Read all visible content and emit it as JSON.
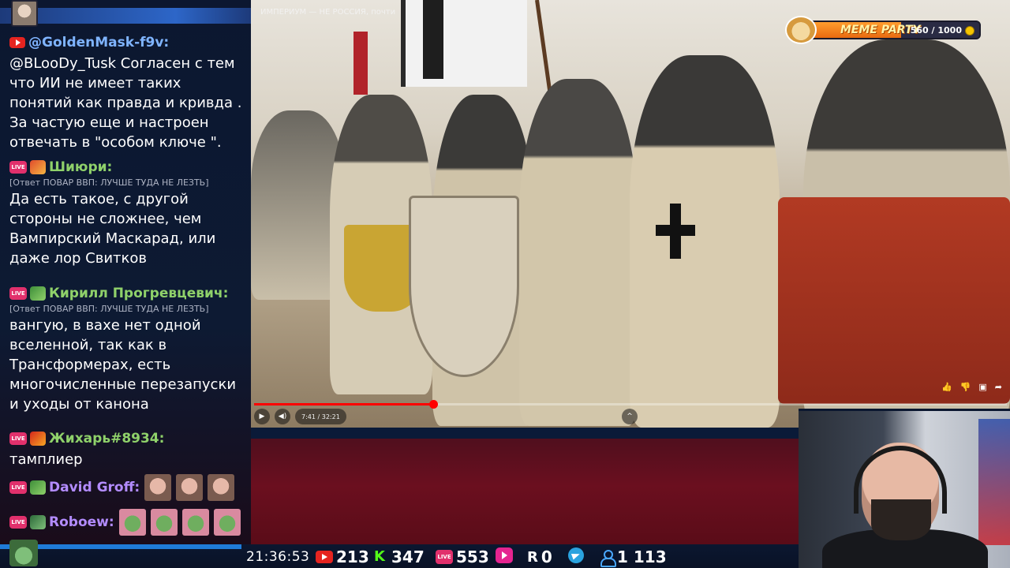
{
  "chat": {
    "messages": [
      {
        "platform": "youtube",
        "author": "@GoldenMask-f9v:",
        "author_color": "#7fb4ff",
        "reply": "",
        "text": "@BLooDy_Tusk Согласен с тем что ИИ не имеет таких понятий как правда и кривда . За частую еще и настроен отвечать в \"особом ключе \"."
      },
      {
        "platform": "live",
        "author": "Шиюри:",
        "author_color": "#8fd16a",
        "reply": "[Ответ ПОВАР ВВП: ЛУЧШЕ ТУДА НЕ ЛЕЗТЬ]",
        "text": "Да есть такое, с другой стороны не сложнее, чем Вампирский Маскарад, или даже лор Свитков"
      },
      {
        "platform": "live",
        "author": "Кирилл Прогревцевич:",
        "author_color": "#8fd16a",
        "reply": "[Ответ ПОВАР ВВП: ЛУЧШЕ ТУДА НЕ ЛЕЗТЬ]",
        "text": "вангую, в вахе нет одной вселенной, так как в Трансформерах, есть многочисленные перезапуски и уходы от канона"
      },
      {
        "platform": "live",
        "author": "Жихарь#8934:",
        "author_color": "#8fd16a",
        "reply": "",
        "text": "тамплиер"
      },
      {
        "platform": "live",
        "author": "David Groff:",
        "author_color": "#b38cff",
        "reply": "",
        "text": ""
      },
      {
        "platform": "live",
        "author": "Roboew:",
        "author_color": "#b38cff",
        "reply": "",
        "text": ""
      }
    ],
    "live_badge": "LIVE"
  },
  "video": {
    "title_overlay": "ИМПЕРИУМ — НЕ РОССИЯ, почти",
    "time": "7:41 / 32:21",
    "progress": 0.238,
    "accent": "#ff0000"
  },
  "meme_party": {
    "label": "MEME PARTY",
    "count": "560 / 1000",
    "progress": 0.56
  },
  "statusbar": {
    "clock": "21:36:53",
    "youtube_count": "213",
    "kick_count": "347",
    "live_count": "553",
    "rutube_count": "0",
    "total_viewers": "1 113",
    "kick_letter": "K",
    "r_letter": "R",
    "live_label": "LIVE"
  }
}
